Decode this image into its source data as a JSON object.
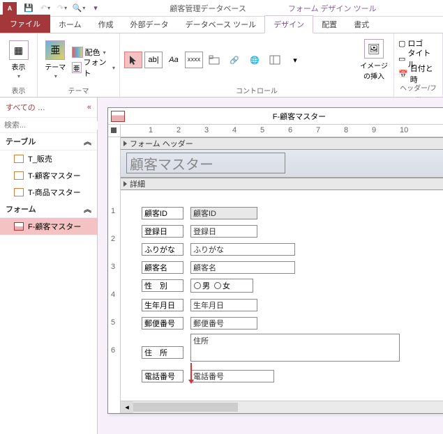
{
  "titlebar": {
    "app_icon_text": "A",
    "db_title": "顧客管理データベース",
    "tool_title": "フォーム デザイン ツール"
  },
  "tabs": {
    "file": "ファイル",
    "home": "ホーム",
    "create": "作成",
    "external": "外部データ",
    "dbtools": "データベース ツール",
    "design": "デザイン",
    "arrange": "配置",
    "format": "書式"
  },
  "ribbon": {
    "view_group": "表示",
    "view_btn": "表示",
    "theme_group": "テーマ",
    "theme_btn": "テーマ",
    "colors": "配色",
    "fonts": "フォント",
    "controls_group": "コントロール",
    "aa": "Aa",
    "xxxx": "XXXX",
    "image_btn": "イメージの挿入",
    "hdrftr_group": "ヘッダー/フッ",
    "logo": "ロゴ",
    "title": "タイトル",
    "datetime": "日付と時"
  },
  "nav": {
    "header": "すべての …",
    "search_placeholder": "検索...",
    "tables_hdr": "テーブル",
    "forms_hdr": "フォーム",
    "tables": [
      "T_販売",
      "T-顧客マスター",
      "T-商品マスター"
    ],
    "forms": [
      "F-顧客マスター"
    ]
  },
  "form": {
    "window_title": "F-顧客マスター",
    "section_header": "フォーム ヘッダー",
    "section_detail": "詳細",
    "title_text": "顧客マスター",
    "fields": {
      "id_lbl": "顧客ID",
      "id_ctrl": "顧客ID",
      "regdate_lbl": "登録日",
      "regdate_ctrl": "登録日",
      "kana_lbl": "ふりがな",
      "kana_ctrl": "ふりがな",
      "name_lbl": "顧客名",
      "name_ctrl": "顧客名",
      "gender_lbl": "性　別",
      "gender_m": "男",
      "gender_f": "女",
      "birth_lbl": "生年月日",
      "birth_ctrl": "生年月日",
      "zip_lbl": "郵便番号",
      "zip_ctrl": "郵便番号",
      "addr_lbl": "住　所",
      "addr_ctrl": "住所",
      "tel_lbl": "電話番号",
      "tel_ctrl": "電話番号"
    }
  },
  "ruler_h": [
    "1",
    "2",
    "3",
    "4",
    "5",
    "6",
    "7",
    "8",
    "9",
    "10"
  ],
  "ruler_v": [
    "1",
    "2",
    "3",
    "4",
    "5",
    "6"
  ]
}
